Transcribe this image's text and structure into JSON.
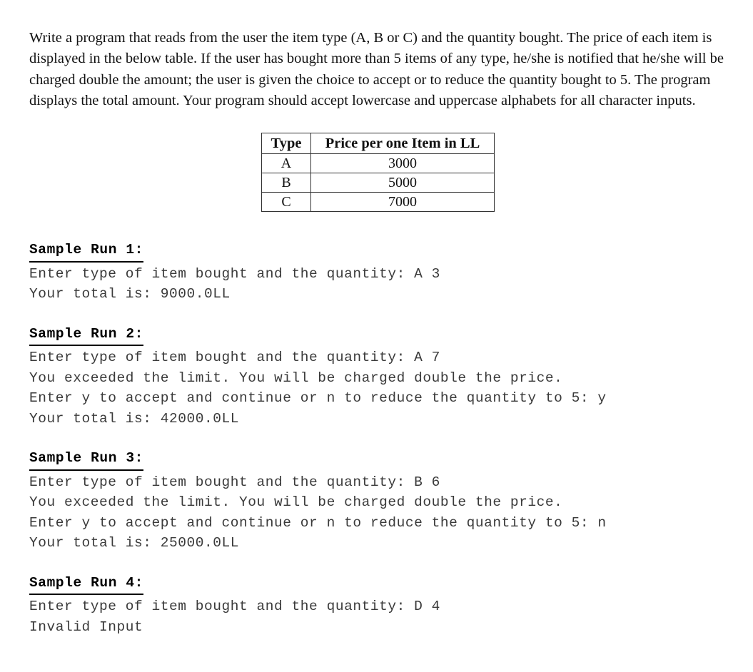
{
  "problem": {
    "statement": "Write a program that reads from the user the item type (A, B or C) and the quantity bought. The price of each item is displayed in the below table. If the user has bought more than 5 items of any type, he/she is notified that he/she will be charged double the amount; the user is given the choice to accept or to reduce the quantity bought to 5. The program displays the total amount. Your program should accept lowercase and uppercase alphabets for all character inputs."
  },
  "price_table": {
    "headers": [
      "Type",
      "Price per one Item in LL"
    ],
    "rows": [
      {
        "type": "A",
        "price": "3000"
      },
      {
        "type": "B",
        "price": "5000"
      },
      {
        "type": "C",
        "price": "7000"
      }
    ]
  },
  "sample_runs": [
    {
      "heading": "Sample Run 1:",
      "lines": [
        "Enter type of item bought and the quantity: A 3",
        "Your total is: 9000.0LL"
      ]
    },
    {
      "heading": "Sample Run 2:",
      "lines": [
        "Enter type of item bought and the quantity: A 7",
        "You exceeded the limit. You will be charged double the price.",
        "Enter y to accept and continue or n to reduce the quantity to 5: y",
        "Your total is: 42000.0LL"
      ]
    },
    {
      "heading": "Sample Run 3:",
      "lines": [
        "Enter type of item bought and the quantity: B 6",
        "You exceeded the limit. You will be charged double the price.",
        "Enter y to accept and continue or n to reduce the quantity to 5: n",
        "Your total is: 25000.0LL"
      ]
    },
    {
      "heading": "Sample Run 4:",
      "lines": [
        "Enter type of item bought and the quantity: D 4",
        "Invalid Input"
      ]
    }
  ]
}
